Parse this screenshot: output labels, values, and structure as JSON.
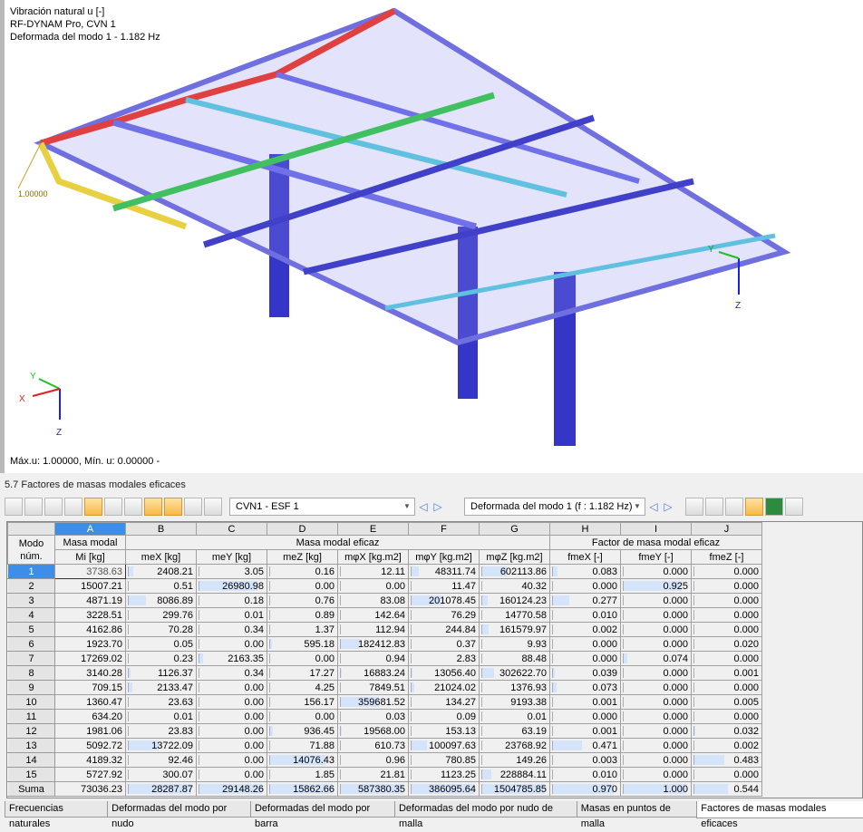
{
  "viewport": {
    "line1": "Vibración natural u [-]",
    "line2": "RF-DYNAM Pro, CVN 1",
    "line3": "Deformada del modo 1 - 1.182 Hz",
    "scale_label": "1.00000",
    "footer": "Máx.u: 1.00000, Mín. u: 0.00000 -",
    "axes": {
      "x": "X",
      "y": "Y",
      "z": "Z"
    },
    "model_axes": {
      "y": "Y",
      "z": "Z"
    }
  },
  "panel": {
    "title": "5.7 Factores de masas modales eficaces"
  },
  "toolbar": {
    "case_select": "CVN1 - ESF 1",
    "mode_select": "Deformada del modo 1 (f : 1.182 Hz)"
  },
  "table": {
    "letters": [
      "A",
      "B",
      "C",
      "D",
      "E",
      "F",
      "G",
      "H",
      "I",
      "J"
    ],
    "header_mode": "Modo",
    "header_num": "núm.",
    "group_a": "Masa modal",
    "group_bg": "Masa modal eficaz",
    "group_hj": "Factor de masa modal eficaz",
    "units": [
      "Mi [kg]",
      "meX [kg]",
      "meY [kg]",
      "meZ [kg]",
      "mφX [kg.m2]",
      "mφY [kg.m2]",
      "mφZ [kg.m2]",
      "fmeX [-]",
      "fmeY [-]",
      "fmeZ [-]"
    ],
    "rows": [
      [
        "1",
        "3738.63",
        "2408.21",
        "3.05",
        "0.16",
        "12.11",
        "48311.74",
        "602113.86",
        "0.083",
        "0.000",
        "0.000"
      ],
      [
        "2",
        "15007.21",
        "0.51",
        "26980.98",
        "0.00",
        "0.00",
        "11.47",
        "40.32",
        "0.000",
        "0.925",
        "0.000"
      ],
      [
        "3",
        "4871.19",
        "8086.89",
        "0.18",
        "0.76",
        "83.08",
        "201078.45",
        "160124.23",
        "0.277",
        "0.000",
        "0.000"
      ],
      [
        "4",
        "3228.51",
        "299.76",
        "0.01",
        "0.89",
        "142.64",
        "76.29",
        "14770.58",
        "0.010",
        "0.000",
        "0.000"
      ],
      [
        "5",
        "4162.86",
        "70.28",
        "0.34",
        "1.37",
        "112.94",
        "244.84",
        "161579.97",
        "0.002",
        "0.000",
        "0.000"
      ],
      [
        "6",
        "1923.70",
        "0.05",
        "0.00",
        "595.18",
        "182412.83",
        "0.37",
        "9.93",
        "0.000",
        "0.000",
        "0.020"
      ],
      [
        "7",
        "17269.02",
        "0.23",
        "2163.35",
        "0.00",
        "0.94",
        "2.83",
        "88.48",
        "0.000",
        "0.074",
        "0.000"
      ],
      [
        "8",
        "3140.28",
        "1126.37",
        "0.34",
        "17.27",
        "16883.24",
        "13056.40",
        "302622.70",
        "0.039",
        "0.000",
        "0.001"
      ],
      [
        "9",
        "709.15",
        "2133.47",
        "0.00",
        "4.25",
        "7849.51",
        "21024.02",
        "1376.93",
        "0.073",
        "0.000",
        "0.000"
      ],
      [
        "10",
        "1360.47",
        "23.63",
        "0.00",
        "156.17",
        "359681.52",
        "134.27",
        "9193.38",
        "0.001",
        "0.000",
        "0.005"
      ],
      [
        "11",
        "634.20",
        "0.01",
        "0.00",
        "0.00",
        "0.03",
        "0.09",
        "0.01",
        "0.000",
        "0.000",
        "0.000"
      ],
      [
        "12",
        "1981.06",
        "23.83",
        "0.00",
        "936.45",
        "19568.00",
        "153.13",
        "63.19",
        "0.001",
        "0.000",
        "0.032"
      ],
      [
        "13",
        "5092.72",
        "13722.09",
        "0.00",
        "71.88",
        "610.73",
        "100097.63",
        "23768.92",
        "0.471",
        "0.000",
        "0.002"
      ],
      [
        "14",
        "4189.32",
        "92.46",
        "0.00",
        "14076.43",
        "0.96",
        "780.85",
        "149.26",
        "0.003",
        "0.000",
        "0.483"
      ],
      [
        "15",
        "5727.92",
        "300.07",
        "0.00",
        "1.85",
        "21.81",
        "1123.25",
        "228884.11",
        "0.010",
        "0.000",
        "0.000"
      ],
      [
        "Suma",
        "73036.23",
        "28287.87",
        "29148.26",
        "15862.66",
        "587380.35",
        "386095.64",
        "1504785.85",
        "0.970",
        "1.000",
        "0.544"
      ]
    ]
  },
  "tabs": [
    "Frecuencias naturales",
    "Deformadas del modo por nudo",
    "Deformadas del modo por barra",
    "Deformadas del modo por nudo de malla",
    "Masas en puntos de malla",
    "Factores de masas modales eficaces"
  ],
  "active_tab": 5,
  "colors": {
    "selection": "#3d8ee8",
    "bar": "#d4e4fb",
    "member": "#6f6fe0"
  }
}
